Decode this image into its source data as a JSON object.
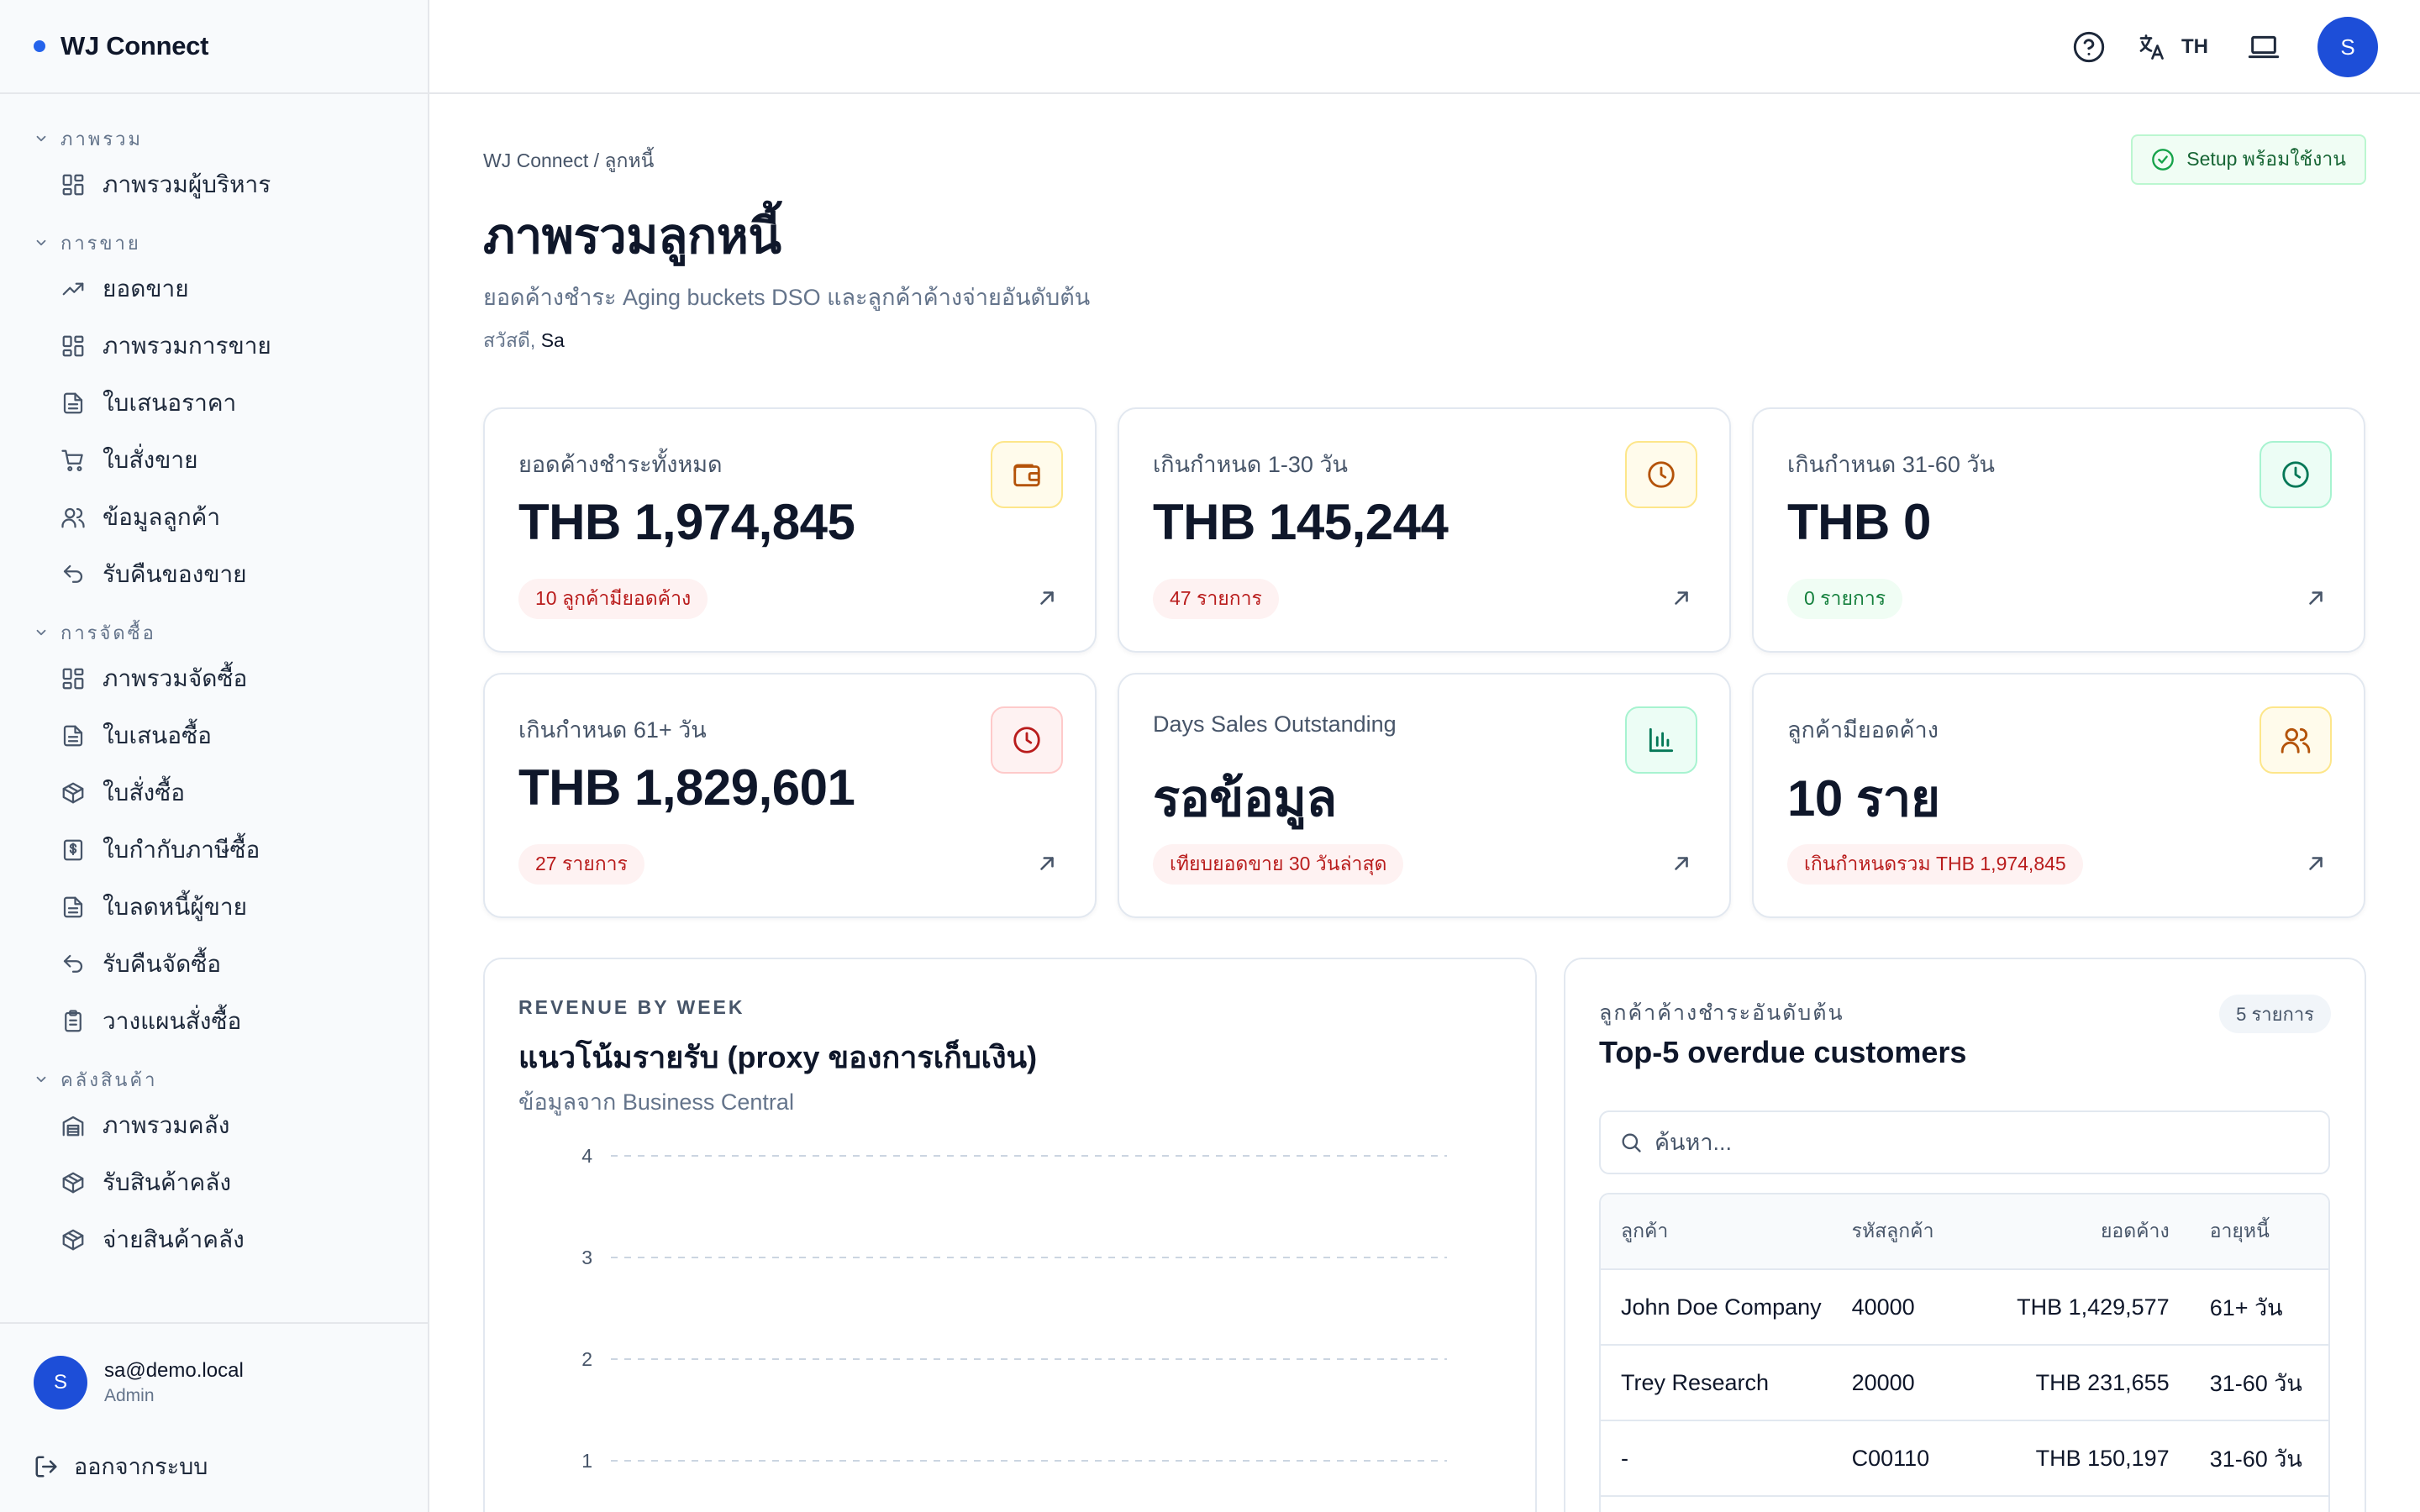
{
  "app": {
    "brand": "WJ Connect"
  },
  "nav": {
    "groups": [
      {
        "label": "ภาพรวม",
        "items": [
          {
            "label": "ภาพรวมผู้บริหาร",
            "icon": "grid-icon"
          }
        ]
      },
      {
        "label": "การขาย",
        "items": [
          {
            "label": "ยอดขาย",
            "icon": "trend-up-icon"
          },
          {
            "label": "ภาพรวมการขาย",
            "icon": "grid-icon"
          },
          {
            "label": "ใบเสนอราคา",
            "icon": "document-icon"
          },
          {
            "label": "ใบสั่งขาย",
            "icon": "cart-icon"
          },
          {
            "label": "ข้อมูลลูกค้า",
            "icon": "users-icon"
          },
          {
            "label": "รับคืนของขาย",
            "icon": "undo-icon"
          }
        ]
      },
      {
        "label": "การจัดซื้อ",
        "items": [
          {
            "label": "ภาพรวมจัดซื้อ",
            "icon": "grid-icon"
          },
          {
            "label": "ใบเสนอซื้อ",
            "icon": "document-icon"
          },
          {
            "label": "ใบสั่งซื้อ",
            "icon": "package-icon"
          },
          {
            "label": "ใบกำกับภาษีซื้อ",
            "icon": "receipt-icon"
          },
          {
            "label": "ใบลดหนี้ผู้ขาย",
            "icon": "document-icon"
          },
          {
            "label": "รับคืนจัดซื้อ",
            "icon": "undo-icon"
          },
          {
            "label": "วางแผนสั่งซื้อ",
            "icon": "clipboard-icon"
          }
        ]
      },
      {
        "label": "คลังสินค้า",
        "items": [
          {
            "label": "ภาพรวมคลัง",
            "icon": "warehouse-icon"
          },
          {
            "label": "รับสินค้าคลัง",
            "icon": "package-icon"
          },
          {
            "label": "จ่ายสินค้าคลัง",
            "icon": "package-icon"
          }
        ]
      }
    ]
  },
  "user": {
    "email": "sa@demo.local",
    "role": "Admin",
    "initial": "S",
    "logout_label": "ออกจากระบบ"
  },
  "topbar": {
    "lang": "TH",
    "avatar_initial": "S"
  },
  "page": {
    "breadcrumb": "WJ Connect / ลูกหนี้",
    "setup_badge": "Setup พร้อมใช้งาน",
    "title": "ภาพรวมลูกหนี้",
    "subtitle": "ยอดค้างชำระ Aging buckets DSO และลูกค้าค้างจ่ายอันดับต้น",
    "greeting_prefix": "สวัสดี,",
    "greeting_name": "Sa"
  },
  "kpis": [
    {
      "label": "ยอดค้างชำระทั้งหมด",
      "value": "THB 1,974,845",
      "pill": "10 ลูกค้ามียอดค้าง",
      "pill_tone": "red",
      "icon": "wallet-icon",
      "icon_tone": "amber"
    },
    {
      "label": "เกินกำหนด 1-30 วัน",
      "value": "THB 145,244",
      "pill": "47 รายการ",
      "pill_tone": "red",
      "icon": "clock-icon",
      "icon_tone": "amber"
    },
    {
      "label": "เกินกำหนด 31-60 วัน",
      "value": "THB 0",
      "pill": "0 รายการ",
      "pill_tone": "green",
      "icon": "clock-icon",
      "icon_tone": "green"
    },
    {
      "label": "เกินกำหนด 61+ วัน",
      "value": "THB 1,829,601",
      "pill": "27 รายการ",
      "pill_tone": "red",
      "icon": "clock-icon",
      "icon_tone": "red"
    },
    {
      "label": "Days Sales Outstanding",
      "value": "รอข้อมูล",
      "pill": "เทียบยอดขาย 30 วันล่าสุด",
      "pill_tone": "red",
      "icon": "bar-chart-icon",
      "icon_tone": "green"
    },
    {
      "label": "ลูกค้ามียอดค้าง",
      "value": "10 ราย",
      "pill": "เกินกำหนดรวม THB 1,974,845",
      "pill_tone": "red",
      "icon": "users-icon",
      "icon_tone": "amber"
    }
  ],
  "revenue": {
    "eyebrow": "REVENUE BY WEEK",
    "title": "แนวโน้มรายรับ (proxy ของการเก็บเงิน)",
    "subtitle": "ข้อมูลจาก Business Central"
  },
  "chart_data": {
    "type": "line",
    "title": "แนวโน้มรายรับ (proxy ของการเก็บเงิน)",
    "y_ticks": [
      4,
      3,
      2,
      1
    ],
    "ylim": [
      0,
      4
    ],
    "grid": true,
    "series": []
  },
  "top_customers": {
    "eyebrow": "ลูกค้าค้างชำระอันดับต้น",
    "title": "Top-5 overdue customers",
    "count_badge": "5 รายการ",
    "search_placeholder": "ค้นหา...",
    "columns": [
      "ลูกค้า",
      "รหัสลูกค้า",
      "ยอดค้าง",
      "อายุหนี้"
    ],
    "rows": [
      [
        "John Doe Company",
        "40000",
        "THB 1,429,577",
        "61+ วัน"
      ],
      [
        "Trey Research",
        "20000",
        "THB 231,655",
        "31-60 วัน"
      ],
      [
        "-",
        "C00110",
        "THB 150,197",
        "31-60 วัน"
      ]
    ]
  },
  "colors": {
    "accent": "#2563eb",
    "danger": "#b91c1c",
    "success": "#15803d",
    "warning": "#b45309"
  }
}
